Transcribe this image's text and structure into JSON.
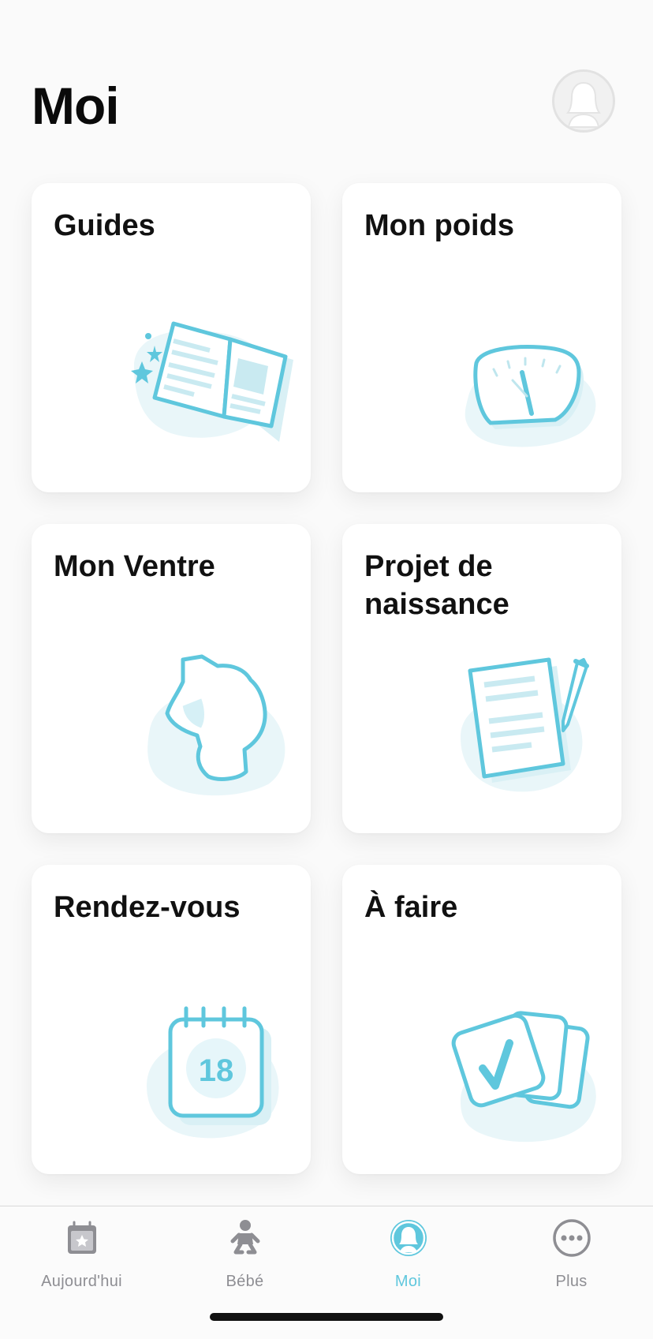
{
  "header": {
    "title": "Moi",
    "avatar_icon": "profile-silhouette-icon"
  },
  "cards": [
    {
      "title": "Guides",
      "icon": "open-book-icon"
    },
    {
      "title": "Mon poids",
      "icon": "scale-icon"
    },
    {
      "title": "Mon Ventre",
      "icon": "pregnant-belly-icon"
    },
    {
      "title": "Projet de naissance",
      "icon": "document-pen-icon"
    },
    {
      "title": "Rendez-vous",
      "icon": "calendar-icon",
      "calendar_day": "18"
    },
    {
      "title": "À faire",
      "icon": "checklist-cards-icon"
    }
  ],
  "tabbar": {
    "tabs": [
      {
        "label": "Aujourd'hui",
        "icon": "calendar-star-icon",
        "active": false
      },
      {
        "label": "Bébé",
        "icon": "baby-icon",
        "active": false
      },
      {
        "label": "Moi",
        "icon": "profile-icon",
        "active": true
      },
      {
        "label": "Plus",
        "icon": "more-dots-icon",
        "active": false
      }
    ]
  },
  "colors": {
    "accent": "#5fc7dd",
    "accent_light": "#e6f6fa",
    "inactive": "#8e8e93"
  }
}
